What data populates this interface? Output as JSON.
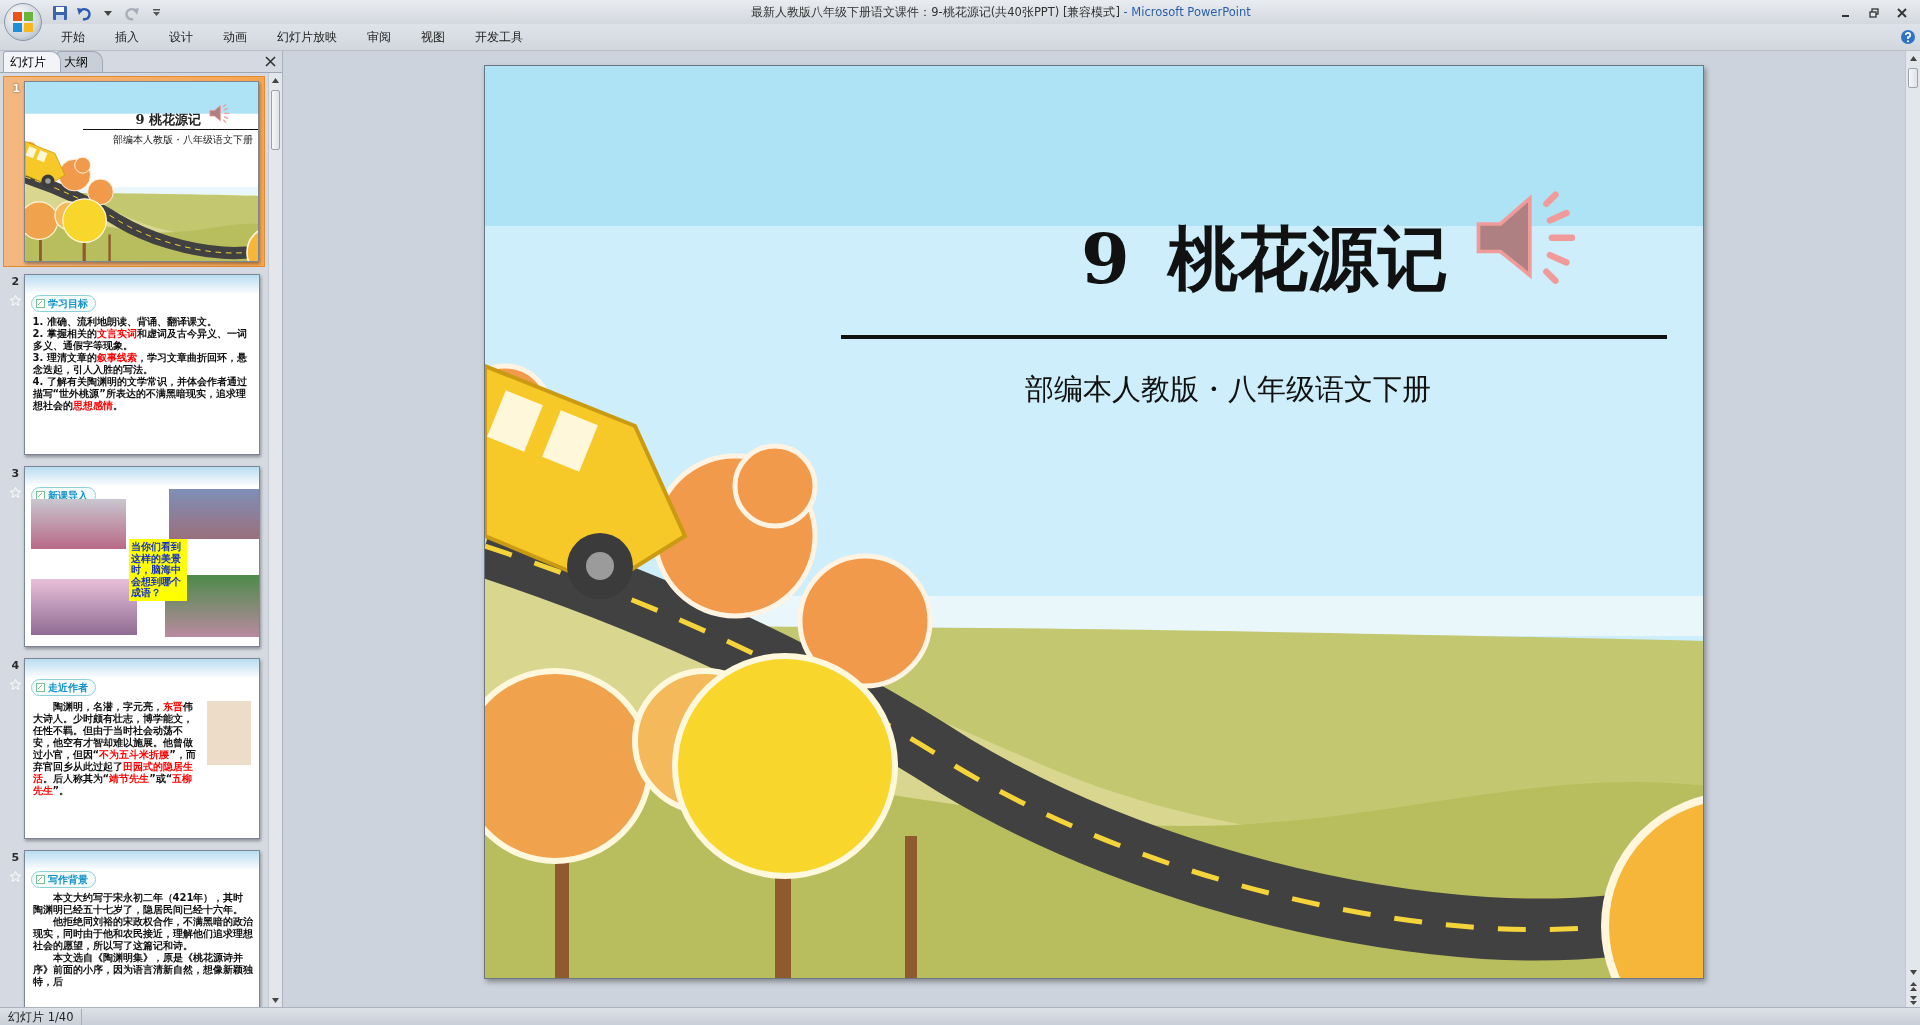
{
  "window": {
    "title": "最新人教版八年级下册语文课件：9-桃花源记(共40张PPT) [兼容模式]",
    "app_name": "- Microsoft PowerPoint"
  },
  "ribbon_tabs": [
    {
      "label": "开始"
    },
    {
      "label": "插入"
    },
    {
      "label": "设计"
    },
    {
      "label": "动画"
    },
    {
      "label": "幻灯片放映"
    },
    {
      "label": "审阅"
    },
    {
      "label": "视图"
    },
    {
      "label": "开发工具"
    }
  ],
  "pane_tabs": [
    {
      "label": "幻灯片",
      "selected": true
    },
    {
      "label": "大纲",
      "selected": false
    }
  ],
  "thumbnails": [
    {
      "number": "1",
      "selected": true,
      "animated": false,
      "kind": "title",
      "title": "9 桃花源记",
      "subtitle": "部编本人教版・八年级语文下册"
    },
    {
      "number": "2",
      "selected": false,
      "animated": true,
      "kind": "list",
      "heading": "学习目标",
      "items": [
        "1. 准确、流利地朗读、背诵、翻译课文。",
        "2. 掌握相关的**文言实词**和虚词及古今异义、一词多义、通假字等现象。",
        "3. 理清文章的**叙事线索**，学习文章曲折回环，悬念迭起，引人入胜的写法。",
        "4. 了解有关陶渊明的文学常识，并体会作者通过描写“世外桃源”所表达的不满黑暗现实，追求理想社会的**思想感情**。"
      ]
    },
    {
      "number": "3",
      "selected": false,
      "animated": true,
      "kind": "photos",
      "heading": "新课导入",
      "callout": "当你们看到这样的美景时，脑海中会想到哪个成语？"
    },
    {
      "number": "4",
      "selected": false,
      "animated": true,
      "kind": "author",
      "heading": "走近作者",
      "text": "陶渊明，名潜，字元亮，**东晋**伟大诗人。少时颇有壮志，博学能文，任性不羁。但由于当时社会动荡不安，他空有才智却难以施展。他曾做过小官，但因“**不为五斗米折腰**”，而弃官回乡从此过起了**田园式的隐居生活**。后人称其为“**靖节先生**”或“**五柳先生**”。"
    },
    {
      "number": "5",
      "selected": false,
      "animated": true,
      "kind": "text",
      "heading": "写作背景",
      "paragraphs": [
        "本文大约写于宋永初二年（421年），其时陶渊明已经五十七岁了，隐居民间已经十六年。",
        "他拒绝同刘裕的宋政权合作，不满黑暗的政治现实，同时由于他和农民接近，理解他们追求理想社会的愿望，所以写了这篇记和诗。",
        "本文选自《陶渊明集》，原是《桃花源诗并序》前面的小序，因为语言清新自然，想像新颖独特，后"
      ]
    }
  ],
  "slide": {
    "title": "9 桃花源记",
    "subtitle": "部编本人教版・八年级语文下册"
  },
  "status_bar": {
    "text": "幻灯片 1/40"
  }
}
